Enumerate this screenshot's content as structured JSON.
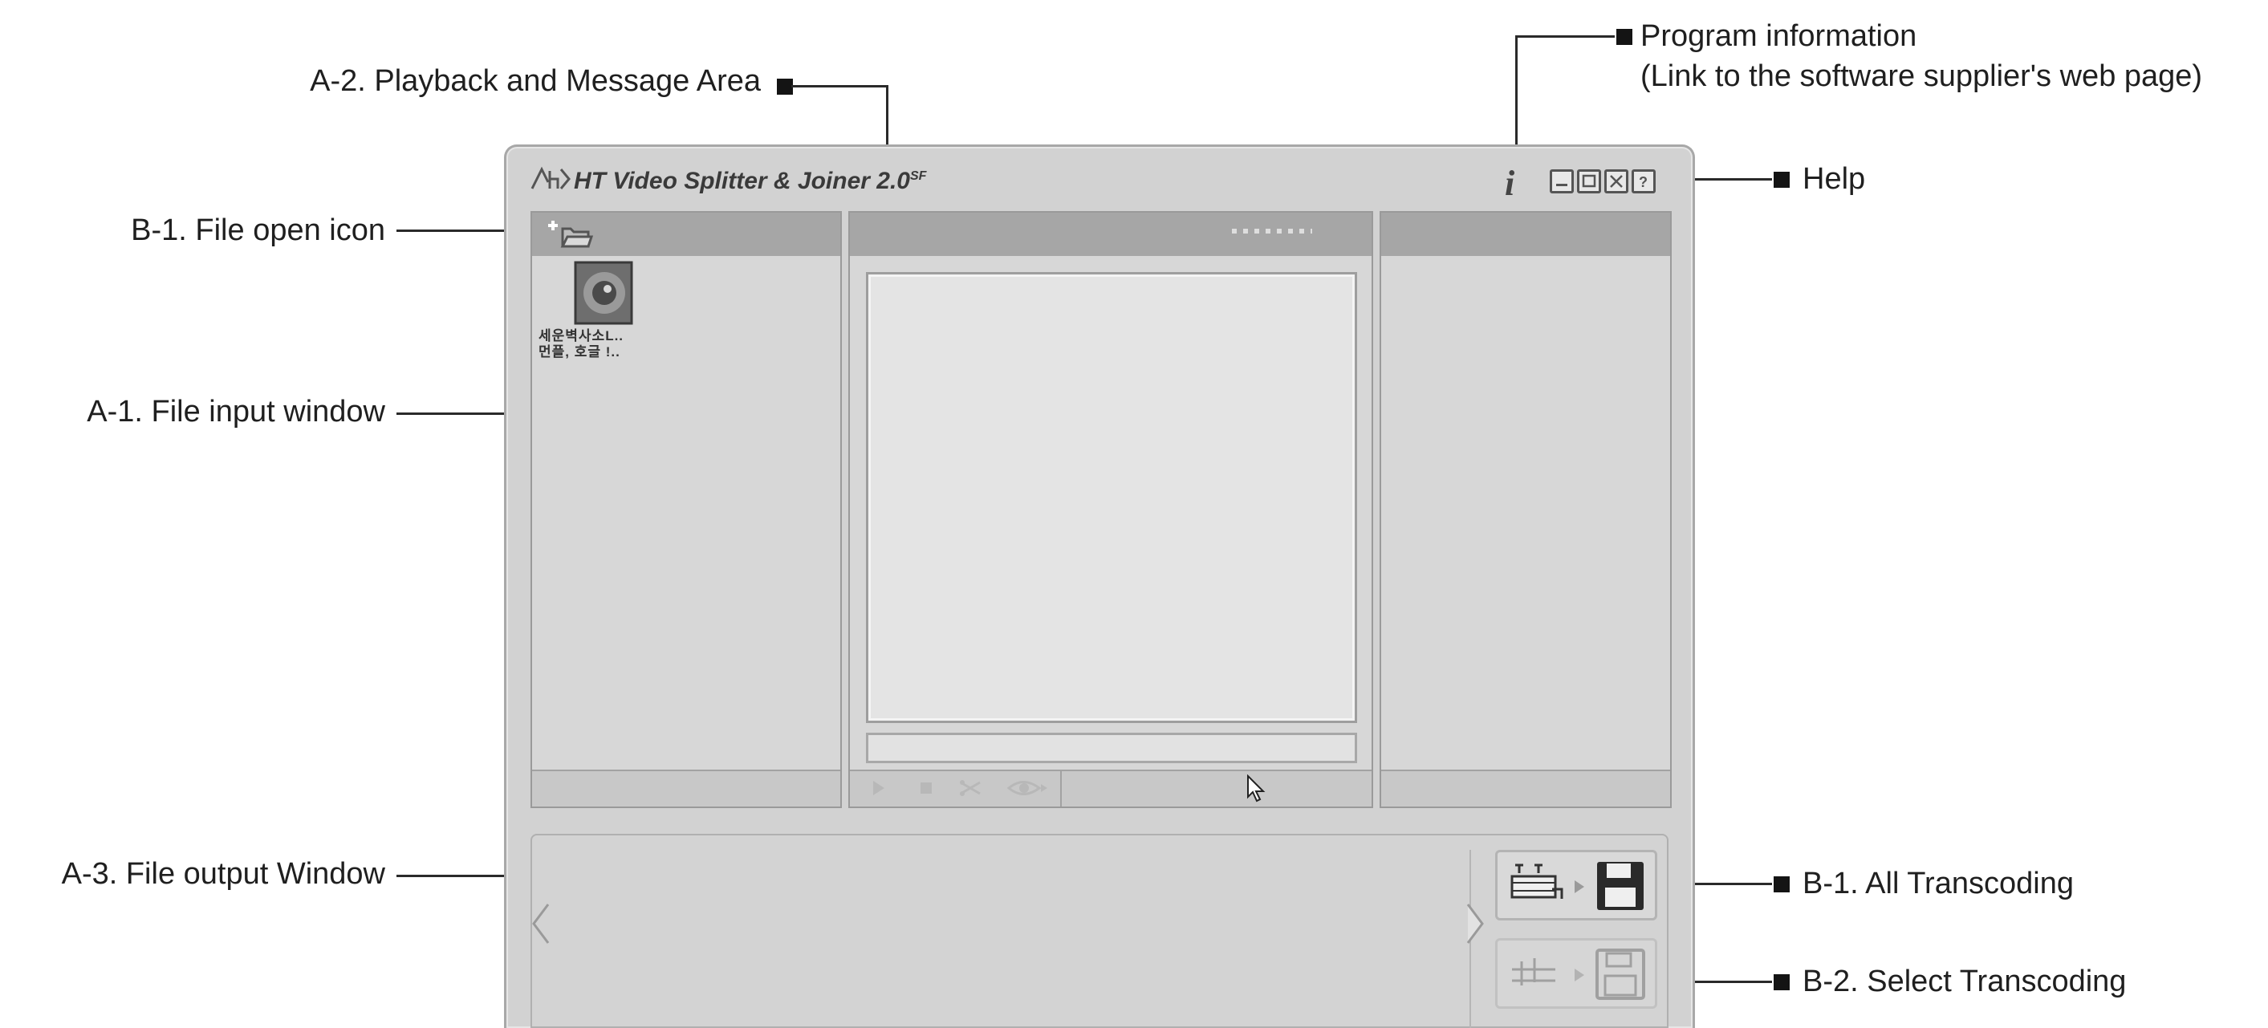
{
  "callouts": {
    "program_info": "Program information",
    "program_info_sub": "(Link to the software supplier's web page)",
    "playback_area": "A-2. Playback and Message Area",
    "help": "Help",
    "file_open_icon": "B-1. File open icon",
    "file_input_window": "A-1. File input window",
    "file_output_window": "A-3. File output Window",
    "all_transcoding": "B-1. All Transcoding",
    "select_transcoding": "B-2. Select Transcoding"
  },
  "app": {
    "logo_text": "ㅅhD",
    "title": "HT Video Splitter & Joiner 2.0",
    "title_suffix": "SF",
    "info_icon": "i"
  },
  "input_panel": {
    "thumb_label_line1": "세운벽사소L..",
    "thumb_label_line2": "먼플, 호글 !.."
  },
  "icons": {
    "file_open": "folder-plus-icon",
    "info": "info-icon",
    "minimize": "minimize-icon",
    "maximize": "maximize-icon",
    "close": "close-icon",
    "help": "help-icon",
    "play": "play-icon",
    "stop": "stop-icon",
    "cut": "scissors-icon",
    "preview": "eye-icon",
    "all_transcode": "film-to-disk-icon",
    "select_transcode": "select-film-to-disk-icon"
  },
  "colors": {
    "window_bg": "#d2d2d2",
    "panel_head": "#a6a6a6",
    "callout_line": "#2a2a2a"
  }
}
